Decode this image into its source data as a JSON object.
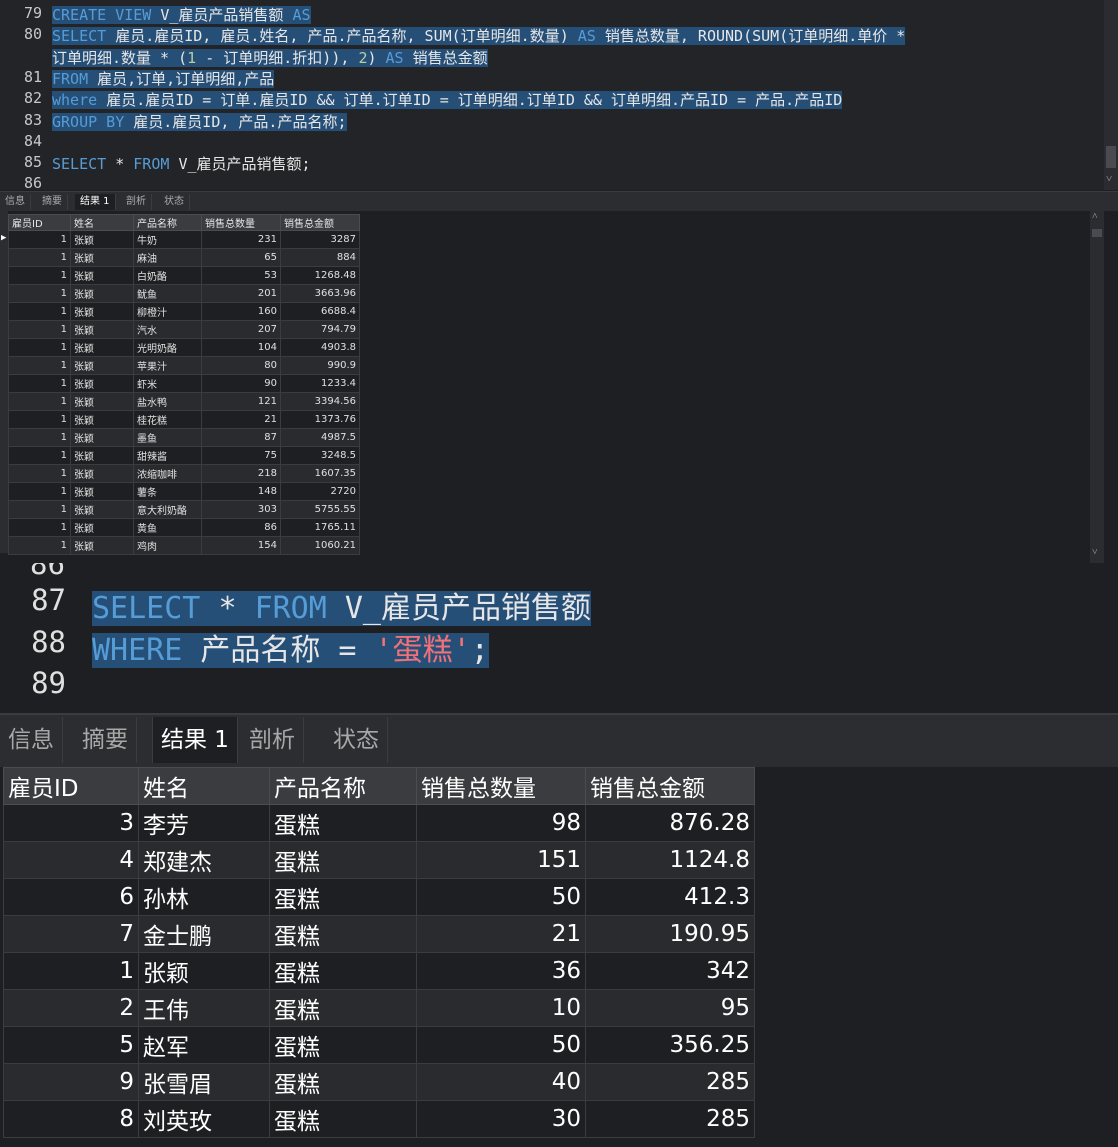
{
  "editor1": {
    "lines": [
      {
        "no": "79",
        "segs": [
          [
            "kw",
            "CREATE VIEW "
          ],
          [
            "txt",
            "V_雇员产品销售额 "
          ],
          [
            "kw",
            "AS"
          ]
        ]
      },
      {
        "no": "80",
        "segs": [
          [
            "kw",
            "SELECT "
          ],
          [
            "txt",
            "雇员.雇员ID, 雇员.姓名, 产品.产品名称, SUM(订单明细.数量) "
          ],
          [
            "kw",
            "AS "
          ],
          [
            "txt",
            "销售总数量, ROUND(SUM(订单明细.单价 *"
          ]
        ]
      },
      {
        "no": "",
        "segs": [
          [
            "txt",
            "订单明细.数量 * ("
          ],
          [
            "num",
            "1"
          ],
          [
            "txt",
            " - 订单明细.折扣)), "
          ],
          [
            "num",
            "2"
          ],
          [
            "txt",
            ") "
          ],
          [
            "kw",
            "AS "
          ],
          [
            "txt",
            "销售总金额"
          ]
        ]
      },
      {
        "no": "81",
        "segs": [
          [
            "kw",
            "FROM "
          ],
          [
            "txt",
            "雇员,订单,订单明细,产品"
          ]
        ]
      },
      {
        "no": "82",
        "segs": [
          [
            "kw",
            "where "
          ],
          [
            "txt",
            "雇员.雇员ID = 订单.雇员ID && 订单.订单ID = 订单明细.订单ID && 订单明细.产品ID = 产品.产品ID"
          ]
        ]
      },
      {
        "no": "83",
        "segs": [
          [
            "kw",
            "GROUP BY "
          ],
          [
            "txt",
            "雇员.雇员ID, 产品.产品名称;"
          ]
        ]
      },
      {
        "no": "84",
        "segs": []
      },
      {
        "no": "85",
        "segs": [
          [
            "kw",
            "SELECT "
          ],
          [
            "txt",
            "* "
          ],
          [
            "kw",
            "FROM "
          ],
          [
            "txt",
            "V_雇员产品销售额;"
          ]
        ]
      },
      {
        "no": "86",
        "segs": []
      }
    ]
  },
  "tabs_small": [
    "信息",
    "摘要",
    "结果 1",
    "剖析",
    "状态"
  ],
  "grid1": {
    "headers": [
      "雇员ID",
      "姓名",
      "产品名称",
      "销售总数量",
      "销售总金额"
    ],
    "rows": [
      [
        "1",
        "张颖",
        "牛奶",
        "231",
        "3287"
      ],
      [
        "1",
        "张颖",
        "麻油",
        "65",
        "884"
      ],
      [
        "1",
        "张颖",
        "白奶酪",
        "53",
        "1268.48"
      ],
      [
        "1",
        "张颖",
        "鱿鱼",
        "201",
        "3663.96"
      ],
      [
        "1",
        "张颖",
        "柳橙汁",
        "160",
        "6688.4"
      ],
      [
        "1",
        "张颖",
        "汽水",
        "207",
        "794.79"
      ],
      [
        "1",
        "张颖",
        "光明奶酪",
        "104",
        "4903.8"
      ],
      [
        "1",
        "张颖",
        "苹果汁",
        "80",
        "990.9"
      ],
      [
        "1",
        "张颖",
        "虾米",
        "90",
        "1233.4"
      ],
      [
        "1",
        "张颖",
        "盐水鸭",
        "121",
        "3394.56"
      ],
      [
        "1",
        "张颖",
        "桂花糕",
        "21",
        "1373.76"
      ],
      [
        "1",
        "张颖",
        "墨鱼",
        "87",
        "4987.5"
      ],
      [
        "1",
        "张颖",
        "甜辣酱",
        "75",
        "3248.5"
      ],
      [
        "1",
        "张颖",
        "浓缩咖啡",
        "218",
        "1607.35"
      ],
      [
        "1",
        "张颖",
        "薯条",
        "148",
        "2720"
      ],
      [
        "1",
        "张颖",
        "意大利奶酪",
        "303",
        "5755.55"
      ],
      [
        "1",
        "张颖",
        "黄鱼",
        "86",
        "1765.11"
      ],
      [
        "1",
        "张颖",
        "鸡肉",
        "154",
        "1060.21"
      ]
    ]
  },
  "editor2": {
    "lines": [
      {
        "no": "87",
        "segs": [
          [
            "kw",
            "SELECT "
          ],
          [
            "txt",
            "* "
          ],
          [
            "kw",
            "FROM "
          ],
          [
            "txt",
            "V_雇员产品销售额"
          ]
        ]
      },
      {
        "no": "88",
        "segs": [
          [
            "kw",
            "WHERE "
          ],
          [
            "txt",
            "产品名称 = "
          ],
          [
            "str",
            "'蛋糕'"
          ],
          [
            "txt",
            ";"
          ]
        ]
      },
      {
        "no": "89",
        "segs": []
      }
    ]
  },
  "tabs_big": [
    "信息",
    "摘要",
    "结果 1",
    "剖析",
    "状态"
  ],
  "grid2": {
    "headers": [
      "雇员ID",
      "姓名",
      "产品名称",
      "销售总数量",
      "销售总金额"
    ],
    "rows": [
      [
        "3",
        "李芳",
        "蛋糕",
        "98",
        "876.28"
      ],
      [
        "4",
        "郑建杰",
        "蛋糕",
        "151",
        "1124.8"
      ],
      [
        "6",
        "孙林",
        "蛋糕",
        "50",
        "412.3"
      ],
      [
        "7",
        "金士鹏",
        "蛋糕",
        "21",
        "190.95"
      ],
      [
        "1",
        "张颖",
        "蛋糕",
        "36",
        "342"
      ],
      [
        "2",
        "王伟",
        "蛋糕",
        "10",
        "95"
      ],
      [
        "5",
        "赵军",
        "蛋糕",
        "50",
        "356.25"
      ],
      [
        "9",
        "张雪眉",
        "蛋糕",
        "40",
        "285"
      ],
      [
        "8",
        "刘英玫",
        "蛋糕",
        "30",
        "285"
      ]
    ]
  },
  "colors": {
    "selection": "#264f78",
    "keyword": "#569cd6",
    "number": "#b5cea8",
    "string": "#f07178"
  }
}
